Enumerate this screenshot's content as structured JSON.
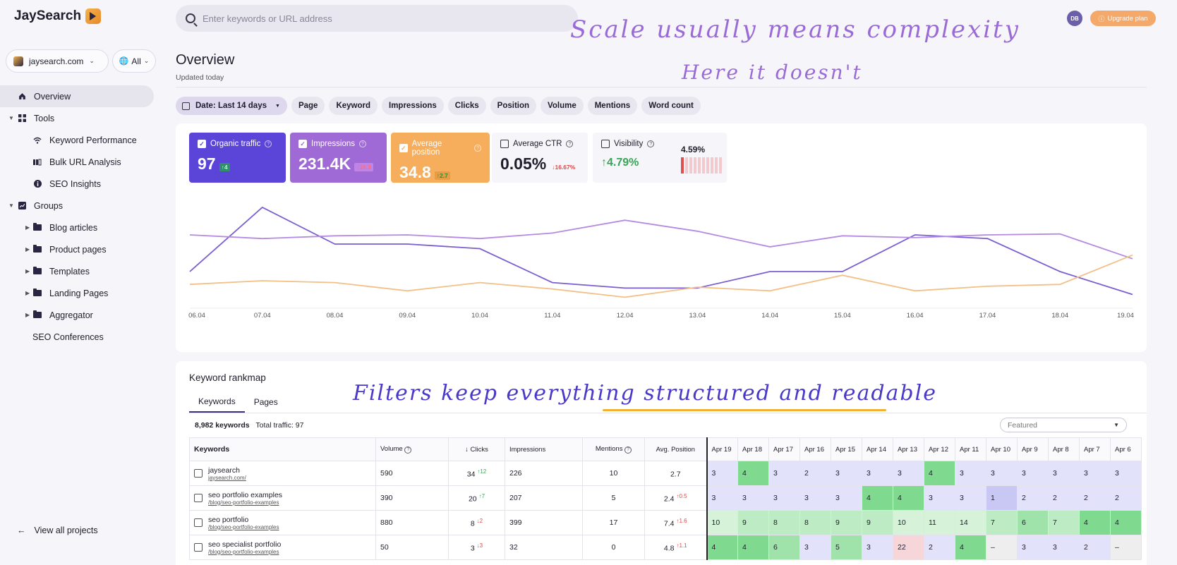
{
  "app": {
    "name": "JaySearch"
  },
  "sidebar": {
    "project": "jaysearch.com",
    "scope": "All",
    "items": [
      {
        "label": "Overview",
        "icon": "home-icon",
        "level": 0
      },
      {
        "label": "Tools",
        "icon": "grid-icon",
        "level": 0
      },
      {
        "label": "Keyword Performance",
        "icon": "signal-icon",
        "level": 1
      },
      {
        "label": "Bulk URL Analysis",
        "icon": "bars-icon",
        "level": 1
      },
      {
        "label": "SEO Insights",
        "icon": "info-icon",
        "level": 1
      },
      {
        "label": "Groups",
        "icon": "chart-icon",
        "level": 0
      },
      {
        "label": "Blog articles",
        "icon": "folder-icon",
        "level": 1
      },
      {
        "label": "Product pages",
        "icon": "folder-icon",
        "level": 1
      },
      {
        "label": "Templates",
        "icon": "folder-icon",
        "level": 1
      },
      {
        "label": "Landing Pages",
        "icon": "folder-icon",
        "level": 1
      },
      {
        "label": "Aggregator",
        "icon": "folder-icon",
        "level": 1
      },
      {
        "label": "SEO Conferences",
        "icon": "",
        "level": 1
      }
    ],
    "view_all": "View all projects"
  },
  "header": {
    "search_placeholder": "Enter keywords or URL address",
    "avatar": "DB",
    "upgrade": "Upgrade plan"
  },
  "page": {
    "title": "Overview",
    "subtitle": "Updated today"
  },
  "filters": [
    "Date: Last 14 days",
    "Page",
    "Keyword",
    "Impressions",
    "Clicks",
    "Position",
    "Volume",
    "Mentions",
    "Word count"
  ],
  "metrics": [
    {
      "label": "Organic traffic",
      "value": "97",
      "delta": "↑4",
      "checked": true,
      "bg": "#5b45d9",
      "fg": "#ffffff"
    },
    {
      "label": "Impressions",
      "value": "231.4K",
      "delta": "↓16.3",
      "checked": true,
      "bg": "#a06ad6",
      "fg": "#ffffff"
    },
    {
      "label": "Average position",
      "value": "34.8",
      "delta": "↑2.7",
      "checked": true,
      "bg": "#f6ad5c",
      "fg": "#ffffff"
    },
    {
      "label": "Average CTR",
      "value": "0.05%",
      "delta": "↓16.67%",
      "checked": false,
      "bg": "#f6f5f9",
      "fg": "#1f1d2b"
    },
    {
      "label": "Visibility",
      "value": "↑4.79%",
      "delta": "4.59%",
      "checked": false,
      "bg": "#f6f5f9",
      "fg": "#3aa357"
    }
  ],
  "chart_data": {
    "type": "line",
    "x": [
      "06.04",
      "07.04",
      "08.04",
      "09.04",
      "10.04",
      "11.04",
      "12.04",
      "13.04",
      "14.04",
      "15.04",
      "16.04",
      "17.04",
      "18.04",
      "19.04"
    ],
    "series": [
      {
        "color": "#7b5fd0",
        "values": [
          4,
          11,
          7,
          7,
          6.5,
          2.8,
          2.2,
          2.2,
          4,
          4,
          8,
          7.6,
          4,
          1.5
        ]
      },
      {
        "color": "#b58ae0",
        "values": [
          8,
          7.6,
          7.9,
          8,
          7.6,
          8.2,
          9.6,
          8.4,
          6.7,
          7.9,
          7.7,
          8,
          8.1,
          5.4
        ]
      },
      {
        "color": "#f3c087",
        "values": [
          2.6,
          3,
          2.8,
          1.9,
          2.8,
          2.1,
          1.2,
          2.3,
          1.9,
          3.6,
          1.9,
          2.4,
          2.6,
          5.8
        ]
      }
    ],
    "ylim": [
      0,
      13
    ],
    "legend": "none"
  },
  "rankmap": {
    "title": "Keyword rankmap",
    "tabs": [
      "Keywords",
      "Pages"
    ],
    "count": "8,982 keywords",
    "total": "Total traffic: 97",
    "sort": "Featured",
    "columns": [
      "Keywords",
      "Volume",
      "↓ Clicks",
      "Impressions",
      "Mentions",
      "Avg. Position"
    ],
    "dates": [
      "Apr 19",
      "Apr 18",
      "Apr 17",
      "Apr 16",
      "Apr 15",
      "Apr 14",
      "Apr 13",
      "Apr 12",
      "Apr 11",
      "Apr 10",
      "Apr 9",
      "Apr 8",
      "Apr 7",
      "Apr 6"
    ],
    "rows": [
      {
        "kw": "jaysearch",
        "url": "jaysearch.com/",
        "vol": "590",
        "clicks": "34",
        "cd": "↑12",
        "cu": true,
        "imp": "226",
        "men": "10",
        "pos": "2.7",
        "pd": "",
        "pu": true,
        "heat": [
          "3",
          "4",
          "3",
          "2",
          "3",
          "3",
          "3",
          "4",
          "3",
          "3",
          "3",
          "3",
          "3",
          "3"
        ]
      },
      {
        "kw": "seo portfolio examples",
        "url": "/blog/seo-portfolio-examples",
        "vol": "390",
        "clicks": "20",
        "cd": "↑7",
        "cu": true,
        "imp": "207",
        "men": "5",
        "pos": "2.4",
        "pd": "↑0.5",
        "pu": false,
        "heat": [
          "3",
          "3",
          "3",
          "3",
          "3",
          "4",
          "4",
          "3",
          "3",
          "1",
          "2",
          "2",
          "2",
          "2"
        ]
      },
      {
        "kw": "seo portfolio",
        "url": "/blog/seo-portfolio-examples",
        "vol": "880",
        "clicks": "8",
        "cd": "↓2",
        "cu": false,
        "imp": "399",
        "men": "17",
        "pos": "7.4",
        "pd": "↑1.6",
        "pu": false,
        "heat": [
          "10",
          "9",
          "8",
          "8",
          "9",
          "9",
          "10",
          "11",
          "14",
          "7",
          "6",
          "7",
          "4",
          "4"
        ]
      },
      {
        "kw": "seo specialist portfolio",
        "url": "/blog/seo-portfolio-examples",
        "vol": "50",
        "clicks": "3",
        "cd": "↓3",
        "cu": false,
        "imp": "32",
        "men": "0",
        "pos": "4.8",
        "pd": "↑1.1",
        "pu": false,
        "heat": [
          "4",
          "4",
          "6",
          "3",
          "5",
          "3",
          "22",
          "2",
          "4",
          "–",
          "3",
          "3",
          "2",
          "–"
        ]
      }
    ]
  },
  "notes": {
    "n1": "Scale usually means complexity",
    "n2": "Here it doesn't",
    "n3": "Filters keep everything structured and readable"
  }
}
